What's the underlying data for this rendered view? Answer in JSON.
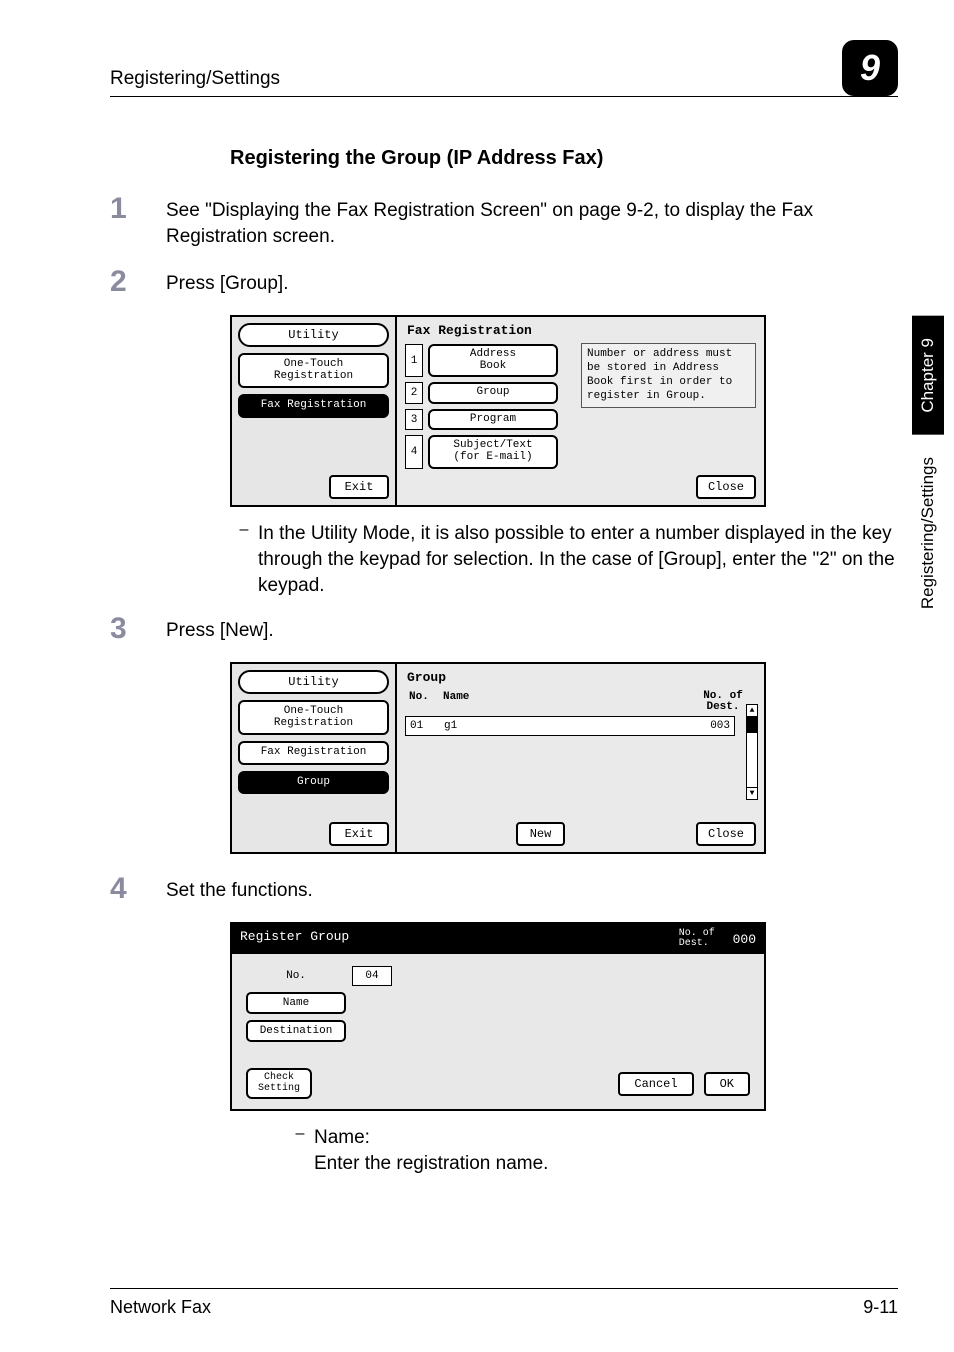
{
  "header": {
    "section": "Registering/Settings",
    "chapter_num": "9"
  },
  "side": {
    "chapter_label": "Chapter 9",
    "section_label": "Registering/Settings"
  },
  "title": "Registering the Group (IP Address Fax)",
  "step1": {
    "num": "1",
    "text": "See \"Displaying the Fax Registration Screen\" on page 9-2, to display the Fax Registration screen."
  },
  "step2": {
    "num": "2",
    "text": "Press [Group]."
  },
  "screen1": {
    "side_title": "Utility",
    "side_items": [
      "One-Touch\nRegistration",
      "Fax Registration"
    ],
    "side_active_index": 1,
    "exit": "Exit",
    "main_title": "Fax Registration",
    "options": [
      {
        "n": "1",
        "label": "Address\nBook"
      },
      {
        "n": "2",
        "label": "Group"
      },
      {
        "n": "3",
        "label": "Program"
      },
      {
        "n": "4",
        "label": "Subject/Text\n(for E-mail)"
      }
    ],
    "info": "Number or address must be stored in Address Book first in order to register in Group.",
    "close": "Close"
  },
  "note2": "In the Utility Mode, it is also possible to enter a number displayed in the key through the keypad for selection. In the case of [Group], enter the \"2\" on the keypad.",
  "step3": {
    "num": "3",
    "text": "Press [New]."
  },
  "screen2": {
    "side_title": "Utility",
    "side_items": [
      "One-Touch\nRegistration",
      "Fax Registration",
      "Group"
    ],
    "side_active_index": 2,
    "exit": "Exit",
    "main_title": "Group",
    "head": {
      "no": "No.",
      "name": "Name",
      "dest": "No. of\nDest."
    },
    "row": {
      "no": "01",
      "name": "g1",
      "dest": "003"
    },
    "new": "New",
    "close": "Close"
  },
  "step4": {
    "num": "4",
    "text": "Set the functions."
  },
  "screen3": {
    "title": "Register Group",
    "dest_label": "No. of\nDest.",
    "dest_val": "000",
    "fields": {
      "no_label": "No.",
      "no_val": "04",
      "name": "Name",
      "destination": "Destination"
    },
    "check": "Check\nSetting",
    "cancel": "Cancel",
    "ok": "OK"
  },
  "step4_note": {
    "head": "Name:",
    "body": "Enter the registration name."
  },
  "footer": {
    "left": "Network Fax",
    "right": "9-11"
  }
}
